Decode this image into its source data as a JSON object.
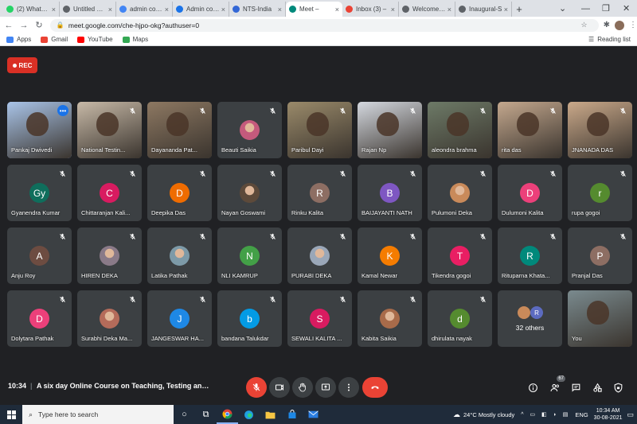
{
  "browser": {
    "tabs": [
      {
        "label": "(2) WhatsApp",
        "color": "#25d366",
        "active": false
      },
      {
        "label": "Untitled Page",
        "color": "#5f6368",
        "active": false
      },
      {
        "label": "admin console",
        "color": "#4285f4",
        "active": false
      },
      {
        "label": "Admin console",
        "color": "#1a73e8",
        "active": false
      },
      {
        "label": "NTS-India",
        "color": "#3367d6",
        "active": false
      },
      {
        "label": "Meet –",
        "color": "#00897b",
        "active": true
      },
      {
        "label": "Inbox (3) –",
        "color": "#ea4335",
        "active": false
      },
      {
        "label": "Welcome to",
        "color": "#5f6368",
        "active": false
      },
      {
        "label": "Inaugural-S",
        "color": "#5f6368",
        "active": false
      }
    ],
    "new_tab": "+",
    "url": "meet.google.com/che-hjpo-okg?authuser=0",
    "bookmarks": [
      {
        "label": "Apps",
        "color": "#4285f4"
      },
      {
        "label": "Gmail",
        "color": "#ea4335"
      },
      {
        "label": "YouTube",
        "color": "#ff0000"
      },
      {
        "label": "Maps",
        "color": "#34a853"
      }
    ],
    "reading_list": "Reading list"
  },
  "meet": {
    "rec_label": "REC",
    "participants": [
      {
        "name": "Pankaj Dwivedi",
        "type": "video",
        "bg": "#a9c4e8",
        "active": true
      },
      {
        "name": "National Testin...",
        "type": "video",
        "bg": "#c7b9a7"
      },
      {
        "name": "Dayananda Pat...",
        "type": "video",
        "bg": "#8d7862"
      },
      {
        "name": "Beauti Saikia",
        "type": "photo",
        "bg": "#c45a7c"
      },
      {
        "name": "Paribul Dayi",
        "type": "video",
        "bg": "#9a8a6a"
      },
      {
        "name": "Rajan Np",
        "type": "video",
        "bg": "#d4d8df"
      },
      {
        "name": "aleondra brahma",
        "type": "video",
        "bg": "#6d7a67"
      },
      {
        "name": "rita das",
        "type": "video",
        "bg": "#c4a88e"
      },
      {
        "name": "JNANADA DAS",
        "type": "video",
        "bg": "#caa98a"
      },
      {
        "name": "Gyanendra Kumar",
        "type": "avatar",
        "initial": "Gy",
        "color": "#0f6e5c"
      },
      {
        "name": "Chittaranjan Kali...",
        "type": "avatar",
        "initial": "C",
        "color": "#d81b60"
      },
      {
        "name": "Deepika Das",
        "type": "avatar",
        "initial": "D",
        "color": "#ef6c00"
      },
      {
        "name": "Nayan Goswami",
        "type": "photo",
        "bg": "#5d4a3a"
      },
      {
        "name": "Rinku Kalita",
        "type": "avatar",
        "initial": "R",
        "color": "#8d6e63"
      },
      {
        "name": "BAIJAYANTI NATH",
        "type": "avatar",
        "initial": "B",
        "color": "#7e57c2"
      },
      {
        "name": "Pulumoni Deka",
        "type": "photo",
        "bg": "#c98a5a"
      },
      {
        "name": "Dulumoni Kalita",
        "type": "avatar",
        "initial": "D",
        "color": "#ec407a"
      },
      {
        "name": "rupa gogoi",
        "type": "avatar",
        "initial": "r",
        "color": "#558b2f"
      },
      {
        "name": "Anju Roy",
        "type": "avatar",
        "initial": "A",
        "color": "#6d4c41"
      },
      {
        "name": "HIREN DEKA",
        "type": "photo",
        "bg": "#8a7a88"
      },
      {
        "name": "Latika Pathak",
        "type": "photo",
        "bg": "#7d9aa8"
      },
      {
        "name": "NLI KAMRUP",
        "type": "avatar",
        "initial": "N",
        "color": "#43a047"
      },
      {
        "name": "PURABI DEKA",
        "type": "photo",
        "bg": "#9aa7b8"
      },
      {
        "name": "Kamal Newar",
        "type": "avatar",
        "initial": "K",
        "color": "#f57c00"
      },
      {
        "name": "Tikendra gogoi",
        "type": "avatar",
        "initial": "T",
        "color": "#e91e63"
      },
      {
        "name": "Rituparna Khata...",
        "type": "avatar",
        "initial": "R",
        "color": "#00897b"
      },
      {
        "name": "Pranjal Das",
        "type": "avatar",
        "initial": "P",
        "color": "#8d6e63"
      },
      {
        "name": "Dolytara Pathak",
        "type": "avatar",
        "initial": "D",
        "color": "#ec407a"
      },
      {
        "name": "Surabhi Deka Ma...",
        "type": "photo",
        "bg": "#b46b5a"
      },
      {
        "name": "JANGESWAR HA...",
        "type": "avatar",
        "initial": "J",
        "color": "#1e88e5"
      },
      {
        "name": "bandana Talukdar",
        "type": "avatar",
        "initial": "b",
        "color": "#039be5"
      },
      {
        "name": "SEWALI KALITA ...",
        "type": "avatar",
        "initial": "S",
        "color": "#d81b60"
      },
      {
        "name": "Kabita Saikia",
        "type": "photo",
        "bg": "#a86b4a"
      },
      {
        "name": "dhirulata nayak",
        "type": "avatar",
        "initial": "d",
        "color": "#558b2f"
      },
      {
        "name": "32 others",
        "type": "others",
        "mini_initial": "R"
      },
      {
        "name": "You",
        "type": "video",
        "bg": "#7a8a8e"
      }
    ],
    "bottom": {
      "time": "10:34",
      "separator": "|",
      "title": "A six day Online Course on Teaching, Testing and E...",
      "people_count": "67"
    }
  },
  "taskbar": {
    "search_placeholder": "Type here to search",
    "weather": "24°C  Mostly cloudy",
    "lang": "ENG",
    "time": "10:34 AM",
    "date": "30-08-2021"
  }
}
